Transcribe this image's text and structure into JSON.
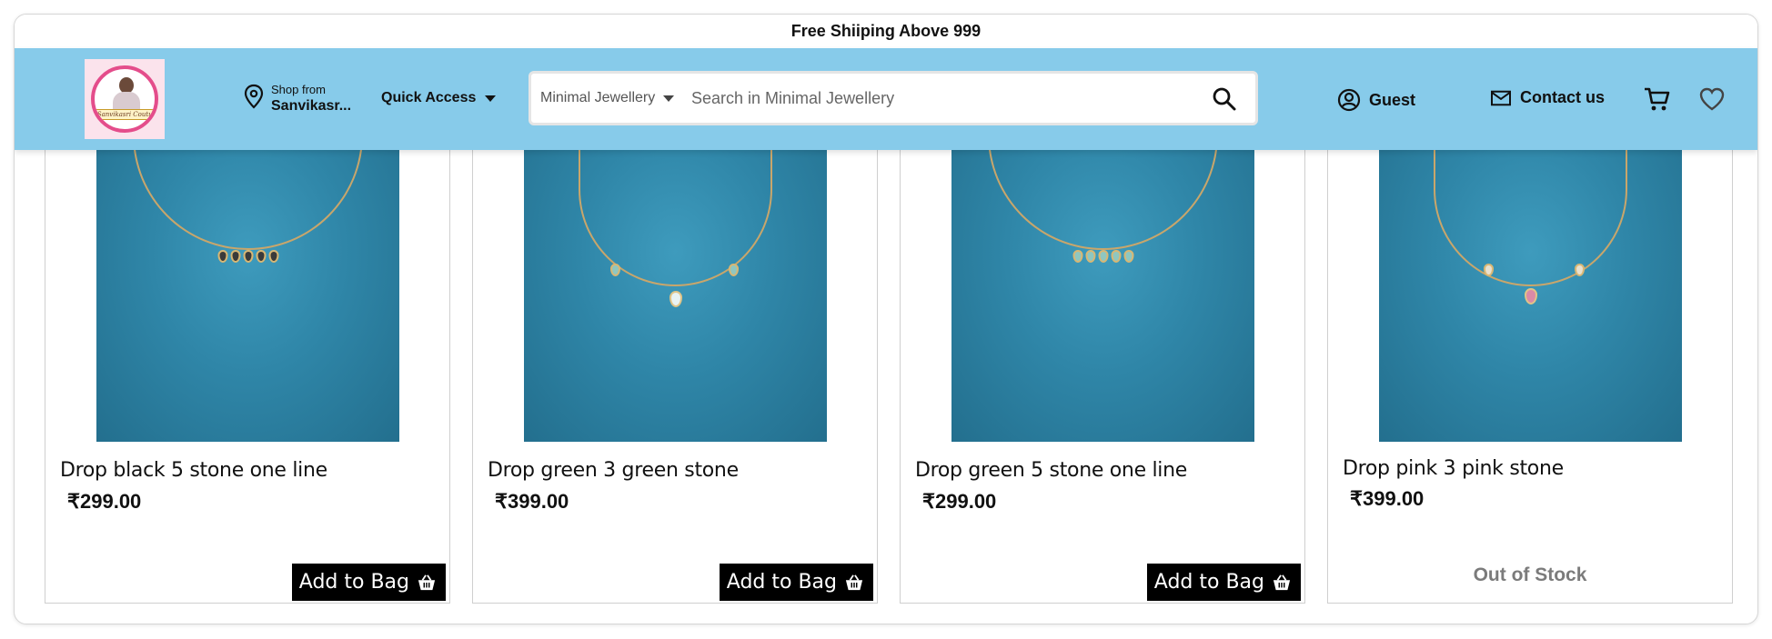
{
  "announcement": "Free Shiiping Above 999",
  "header": {
    "logo_text": "Sanvikasri Couture",
    "shop_from_label": "Shop from",
    "shop_from_value": "Sanvikasr...",
    "quick_access": "Quick Access",
    "search": {
      "category": "Minimal Jewellery",
      "placeholder": "Search in Minimal Jewellery"
    },
    "guest_label": "Guest",
    "contact_label": "Contact us"
  },
  "products": [
    {
      "name": "Drop black 5 stone one line",
      "price": "₹299.00",
      "action": "Add to Bag",
      "in_stock": true,
      "stone_color": "#3a3a3a",
      "stones": 5
    },
    {
      "name": "Drop green 3 green stone",
      "price": "₹399.00",
      "action": "Add to Bag",
      "in_stock": true,
      "stone_color": "#8fc7c0",
      "stones": 3
    },
    {
      "name": "Drop green 5 stone one line",
      "price": "₹299.00",
      "action": "Add to Bag",
      "in_stock": true,
      "stone_color": "#8fc7c0",
      "stones": 5
    },
    {
      "name": "Drop pink 3 pink stone",
      "price": "₹399.00",
      "action": "Out of Stock",
      "in_stock": false,
      "stone_color": "#d98aa7",
      "stones": 3
    }
  ],
  "colors": {
    "header_bg": "#87cbea",
    "button_bg": "#000000",
    "out_of_stock_text": "#7b7b7b"
  }
}
